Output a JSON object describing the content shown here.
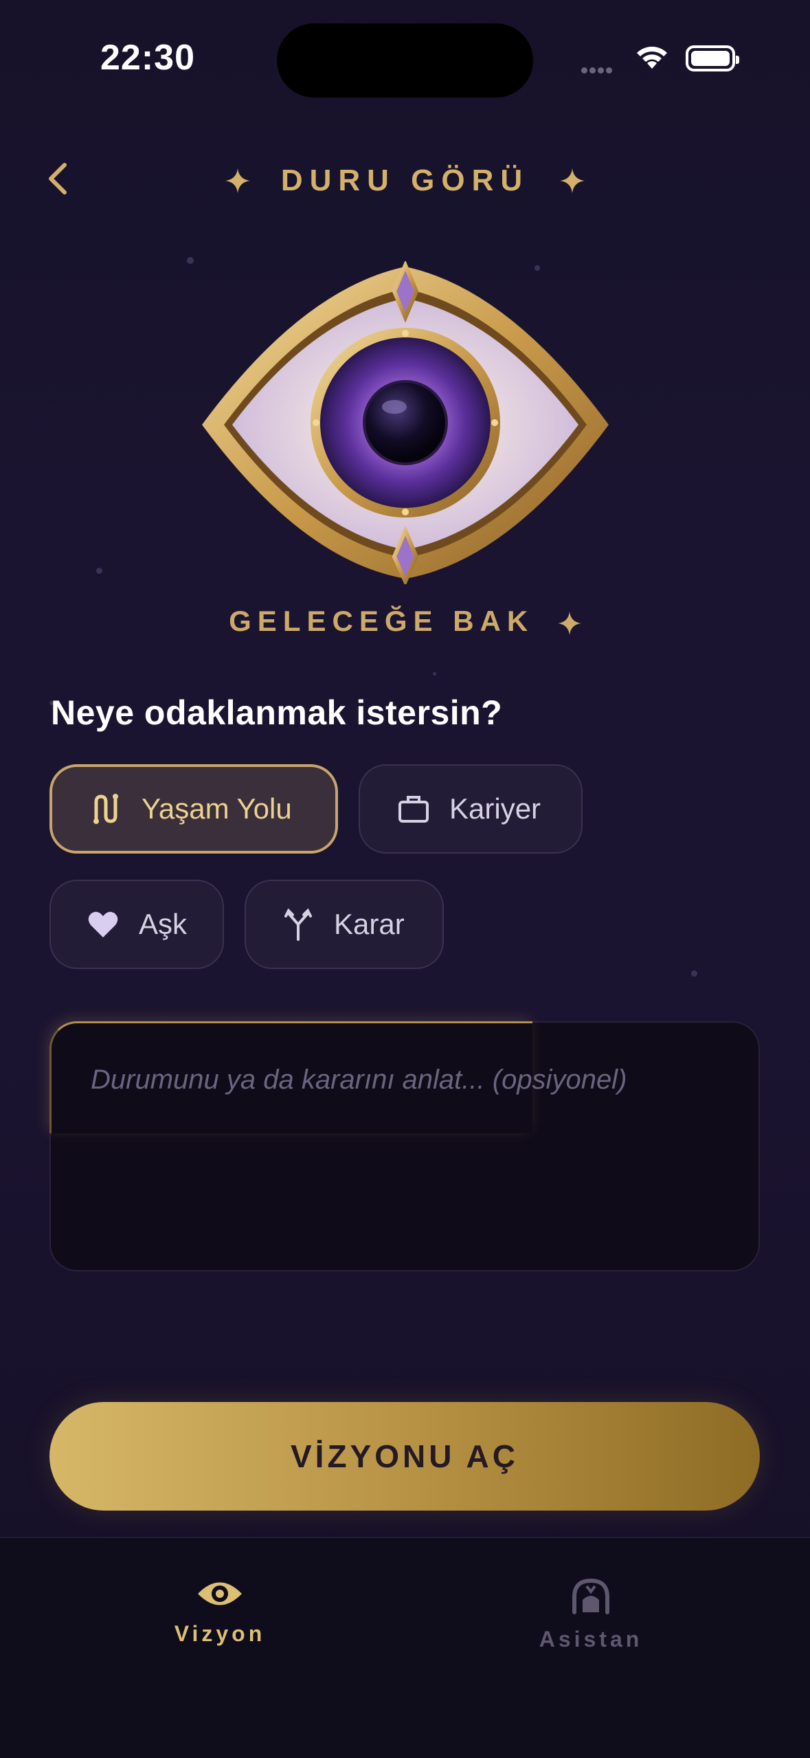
{
  "status_bar": {
    "time": "22:30"
  },
  "header": {
    "title": "DURU GÖRÜ"
  },
  "hero": {
    "subtitle": "GELECEĞE BAK"
  },
  "focus": {
    "question": "Neye odaklanmak istersin?",
    "options": [
      {
        "label": "Yaşam Yolu",
        "icon": "path-icon",
        "selected": true
      },
      {
        "label": "Kariyer",
        "icon": "briefcase-icon",
        "selected": false
      },
      {
        "label": "Aşk",
        "icon": "heart-icon",
        "selected": false
      },
      {
        "label": "Karar",
        "icon": "split-arrows-icon",
        "selected": false
      }
    ]
  },
  "input": {
    "placeholder": "Durumunu ya da kararını anlat... (opsiyonel)"
  },
  "cta": {
    "label": "VİZYONU AÇ"
  },
  "tab_bar": {
    "tabs": [
      {
        "label": "Vizyon",
        "icon": "eye-icon",
        "active": true
      },
      {
        "label": "Asistan",
        "icon": "assistant-icon",
        "active": false
      }
    ]
  },
  "colors": {
    "gold": "#d3b16a",
    "background": "#1a1430",
    "active_chip": "#3b2f3c"
  }
}
